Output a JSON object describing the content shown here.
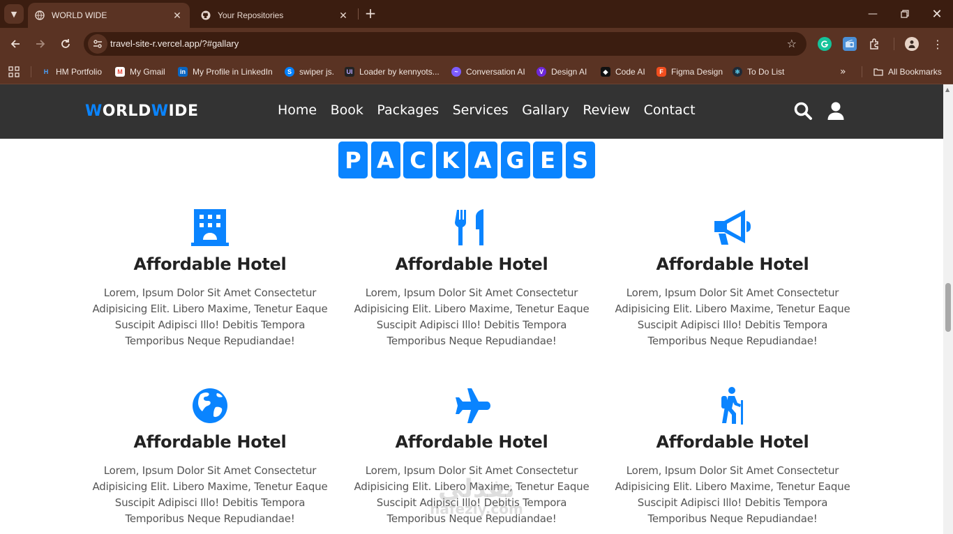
{
  "browser": {
    "tabs": [
      {
        "title": "WORLD WIDE",
        "active": true
      },
      {
        "title": "Your Repositories",
        "active": false
      }
    ],
    "url": "travel-site-r.vercel.app/?#gallary",
    "bookmarks": [
      {
        "label": "HM Portfolio",
        "icon": "hm-portfolio-icon",
        "color": "#1565c0"
      },
      {
        "label": "My Gmail",
        "icon": "gmail-icon",
        "color": "#ea4335"
      },
      {
        "label": "My Profile in LinkedIn",
        "icon": "linkedin-icon",
        "color": "#0a66c2"
      },
      {
        "label": "swiper js.",
        "icon": "swiper-icon",
        "color": "#0080ff"
      },
      {
        "label": "Loader by kennyots...",
        "icon": "uiverse-icon",
        "color": "#222222"
      },
      {
        "label": "Conversation AI",
        "icon": "conversation-ai-icon",
        "color": "#7c5cff"
      },
      {
        "label": "Design AI",
        "icon": "design-ai-icon",
        "color": "#6d28d9"
      },
      {
        "label": "Code AI",
        "icon": "code-ai-icon",
        "color": "#111111"
      },
      {
        "label": "Figma Design",
        "icon": "figma-icon",
        "color": "#f24e1e"
      },
      {
        "label": "To Do List",
        "icon": "react-icon",
        "color": "#1f2a36"
      }
    ],
    "all_bookmarks": "All Bookmarks"
  },
  "site": {
    "logo": {
      "w1": "W",
      "part1": "ORLD",
      "w2": "W",
      "part2": "IDE"
    },
    "nav": [
      "Home",
      "Book",
      "Packages",
      "Services",
      "Gallary",
      "Review",
      "Contact"
    ],
    "section_title_letters": [
      "P",
      "A",
      "C",
      "K",
      "A",
      "G",
      "E",
      "S"
    ],
    "accent_color": "#0a84ff",
    "cards": [
      {
        "icon": "hotel-icon",
        "title": "Affordable Hotel",
        "text": "Lorem, Ipsum Dolor Sit Amet Consectetur Adipisicing Elit. Libero Maxime, Tenetur Eaque Suscipit Adipisci Illo! Debitis Tempora Temporibus Neque Repudiandae!"
      },
      {
        "icon": "utensils-icon",
        "title": "Affordable Hotel",
        "text": "Lorem, Ipsum Dolor Sit Amet Consectetur Adipisicing Elit. Libero Maxime, Tenetur Eaque Suscipit Adipisci Illo! Debitis Tempora Temporibus Neque Repudiandae!"
      },
      {
        "icon": "bullhorn-icon",
        "title": "Affordable Hotel",
        "text": "Lorem, Ipsum Dolor Sit Amet Consectetur Adipisicing Elit. Libero Maxime, Tenetur Eaque Suscipit Adipisci Illo! Debitis Tempora Temporibus Neque Repudiandae!"
      },
      {
        "icon": "globe-icon",
        "title": "Affordable Hotel",
        "text": "Lorem, Ipsum Dolor Sit Amet Consectetur Adipisicing Elit. Libero Maxime, Tenetur Eaque Suscipit Adipisci Illo! Debitis Tempora Temporibus Neque Repudiandae!"
      },
      {
        "icon": "plane-icon",
        "title": "Affordable Hotel",
        "text": "Lorem, Ipsum Dolor Sit Amet Consectetur Adipisicing Elit. Libero Maxime, Tenetur Eaque Suscipit Adipisci Illo! Debitis Tempora Temporibus Neque Repudiandae!"
      },
      {
        "icon": "hiking-icon",
        "title": "Affordable Hotel",
        "text": "Lorem, Ipsum Dolor Sit Amet Consectetur Adipisicing Elit. Libero Maxime, Tenetur Eaque Suscipit Adipisci Illo! Debitis Tempora Temporibus Neque Repudiandae!"
      }
    ]
  },
  "watermark": {
    "main": "نفذلي",
    "sub": "nafezly.com"
  }
}
